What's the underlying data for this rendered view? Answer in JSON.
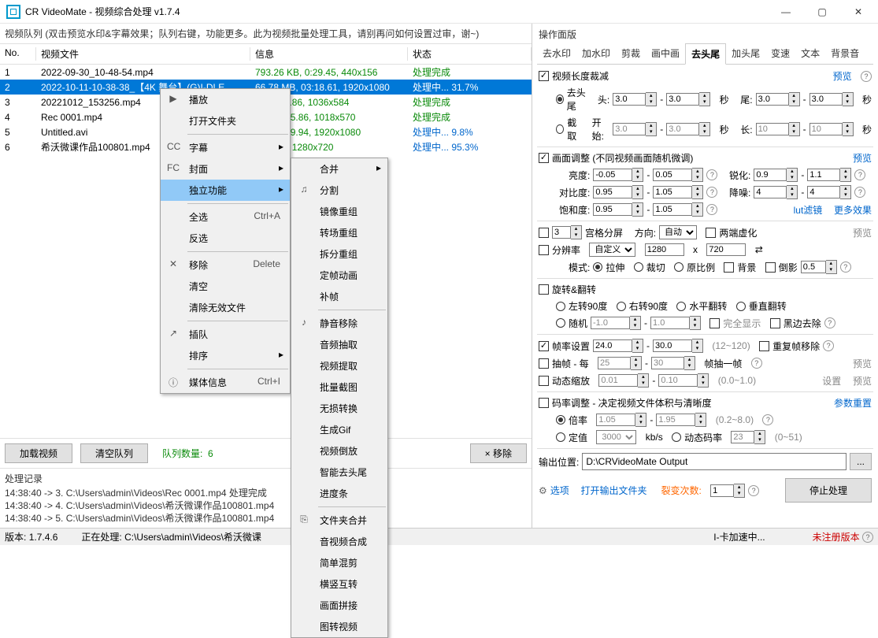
{
  "title": "CR VideoMate - 视频综合处理 v1.7.4",
  "queue_hint": "视频队列 (双击预览水印&字幕效果；队列右键，功能更多。此为视频批量处理工具，请别再问如何设置过审，谢~)",
  "th": {
    "no": "No.",
    "file": "视频文件",
    "info": "信息",
    "stat": "状态"
  },
  "rows": [
    {
      "no": "1",
      "file": "2022-09-30_10-48-54.mp4",
      "info": "793.26 KB, 0:29.45, 440x156",
      "stat": "处理完成",
      "sk": "done"
    },
    {
      "no": "2",
      "file": "2022-10-11-10-38-38_【4K 舞台】(G)I-DLE...",
      "info": "66.78 MB, 03:18.61, 1920x1080",
      "stat": "处理中... 31.7%",
      "sk": "prog",
      "sel": true
    },
    {
      "no": "3",
      "file": "20221012_153256.mp4",
      "info": "3, 01:12.86, 1036x584",
      "stat": "处理完成",
      "sk": "done"
    },
    {
      "no": "4",
      "file": "Rec 0001.mp4",
      "info": "4B, 02:45.86, 1018x570",
      "stat": "处理完成",
      "sk": "done"
    },
    {
      "no": "5",
      "file": "Untitled.avi",
      "info": "4B, 04:29.94, 1920x1080",
      "stat": "处理中... 9.8%",
      "sk": "prog"
    },
    {
      "no": "6",
      "file": "希沃微课作品100801.mp4",
      "info": "0:57.04, 1280x720",
      "stat": "处理中... 95.3%",
      "sk": "prog"
    }
  ],
  "btns": {
    "load": "加载视频",
    "clear": "清空队列",
    "qcount_l": "队列数量:",
    "qcount": "6",
    "remove": "× 移除"
  },
  "log": {
    "title": "处理记录",
    "lines": [
      "14:38:40 -> 3. C:\\Users\\admin\\Videos\\Rec 0001.mp4 处理完成",
      "14:38:40 -> 4. C:\\Users\\admin\\Videos\\希沃微课作品100801.mp4",
      "14:38:40 -> 5. C:\\Users\\admin\\Videos\\希沃微课作品100801.mp4"
    ]
  },
  "status": {
    "ver_l": "版本:",
    "ver": "1.7.4.6",
    "proc_l": "正在处理:",
    "proc": "C:\\Users\\admin\\Videos\\希沃微课",
    "gpu": "I-卡加速中...",
    "unreg": "未注册版本"
  },
  "panel_title": "操作面版",
  "tabs": [
    "去水印",
    "加水印",
    "剪裁",
    "画中画",
    "去头尾",
    "加头尾",
    "变速",
    "文本",
    "背景音"
  ],
  "trim": {
    "title": "视频长度裁减",
    "preview": "预览",
    "head_rb": "去头尾",
    "head_l": "头:",
    "head1": "3.0",
    "head2": "3.0",
    "sec": "秒",
    "tail_l": "尾:",
    "tail1": "3.0",
    "tail2": "3.0",
    "cut_rb": "截取",
    "start_l": "开始:",
    "s1": "3.0",
    "s2": "3.0",
    "len_l": "长:",
    "l1": "10",
    "l2": "10"
  },
  "adj": {
    "title": "画面调整 (不同视频画面随机微调)",
    "preview": "预览",
    "bright": "亮度:",
    "b1": "-0.05",
    "b2": "0.05",
    "sharp": "锐化:",
    "sh1": "0.9",
    "sh2": "1.1",
    "contrast": "对比度:",
    "c1": "0.95",
    "c2": "1.05",
    "noise": "降噪:",
    "n1": "4",
    "n2": "4",
    "sat": "饱和度:",
    "sa1": "0.95",
    "sa2": "1.05",
    "lut": "lut滤镜",
    "more": "更多效果"
  },
  "grid": {
    "num": "3",
    "title": "宫格分屏",
    "dir": "方向:",
    "auto": "自动",
    "virt": "两端虚化",
    "preview": "预览"
  },
  "res": {
    "title": "分辨率",
    "custom": "自定义",
    "w": "1280",
    "x": "x",
    "h": "720",
    "mode": "模式:",
    "stretch": "拉伸",
    "crop": "裁切",
    "orig": "原比例",
    "bg": "背景",
    "mirror": "倒影",
    "mv": "0.5"
  },
  "rot": {
    "title": "旋转&翻转",
    "l90": "左转90度",
    "r90": "右转90度",
    "hflip": "水平翻转",
    "vflip": "垂直翻转",
    "rand": "随机",
    "r1": "-1.0",
    "r2": "1.0",
    "full": "完全显示",
    "border": "黑边去除"
  },
  "fps": {
    "title": "帧率设置",
    "f1": "24.0",
    "f2": "30.0",
    "range": "(12~120)",
    "repeat": "重复帧移除"
  },
  "frame": {
    "title": "抽帧 - 每",
    "f1": "25",
    "f2": "30",
    "ext": "帧抽一帧",
    "preview": "预览"
  },
  "zoom": {
    "title": "动态缩放",
    "z1": "0.01",
    "z2": "0.10",
    "range": "(0.0~1.0)",
    "set": "设置",
    "preview": "预览"
  },
  "rate": {
    "title": "码率调整 - 决定视频文件体积与清晰度",
    "reset": "参数重置",
    "ratio": "倍率",
    "r1": "1.05",
    "r2": "1.95",
    "range": "(0.2~8.0)",
    "fixed": "定值",
    "fx": "3000",
    "unit": "kb/s",
    "dyn": "动态码率",
    "dv": "23",
    "drange": "(0~51)"
  },
  "out": {
    "label": "输出位置:",
    "path": "D:\\CRVideoMate Output",
    "browse": "..."
  },
  "bottom": {
    "opts": "选项",
    "open": "打开输出文件夹",
    "split_l": "裂变次数:",
    "split": "1",
    "stop": "停止处理"
  },
  "ctx1": [
    {
      "ic": "▶",
      "t": "播放"
    },
    {
      "t": "打开文件夹"
    },
    {
      "sep": 1
    },
    {
      "ic": "CC",
      "t": "字幕",
      "arr": 1
    },
    {
      "ic": "FC",
      "t": "封面",
      "arr": 1
    },
    {
      "t": "独立功能",
      "arr": 1,
      "hl": 1
    },
    {
      "sep": 1
    },
    {
      "t": "全选",
      "sc": "Ctrl+A"
    },
    {
      "t": "反选"
    },
    {
      "sep": 1
    },
    {
      "ic": "✕",
      "t": "移除",
      "sc": "Delete"
    },
    {
      "t": "清空"
    },
    {
      "t": "清除无效文件"
    },
    {
      "sep": 1
    },
    {
      "ic": "↗",
      "t": "插队"
    },
    {
      "t": "排序",
      "arr": 1
    },
    {
      "sep": 1
    },
    {
      "ic": "ⓘ",
      "t": "媒体信息",
      "sc": "Ctrl+I"
    }
  ],
  "ctx2": [
    {
      "ic": "",
      "t": "合并",
      "arr": 1
    },
    {
      "ic": "♫",
      "t": "分割"
    },
    {
      "t": "镜像重组"
    },
    {
      "t": "转场重组"
    },
    {
      "t": "拆分重组"
    },
    {
      "t": "定帧动画"
    },
    {
      "t": "补帧"
    },
    {
      "sep": 1
    },
    {
      "ic": "♪",
      "t": "静音移除"
    },
    {
      "t": "音频抽取"
    },
    {
      "t": "视频提取"
    },
    {
      "t": "批量截图"
    },
    {
      "t": "无损转换"
    },
    {
      "t": "生成Gif"
    },
    {
      "t": "视频倒放"
    },
    {
      "t": "智能去头尾"
    },
    {
      "t": "进度条"
    },
    {
      "sep": 1
    },
    {
      "ic": "⎘",
      "t": "文件夹合并"
    },
    {
      "t": "音视频合成"
    },
    {
      "t": "简单混剪"
    },
    {
      "t": "横竖互转"
    },
    {
      "t": "画面拼接"
    },
    {
      "t": "图转视频"
    }
  ]
}
